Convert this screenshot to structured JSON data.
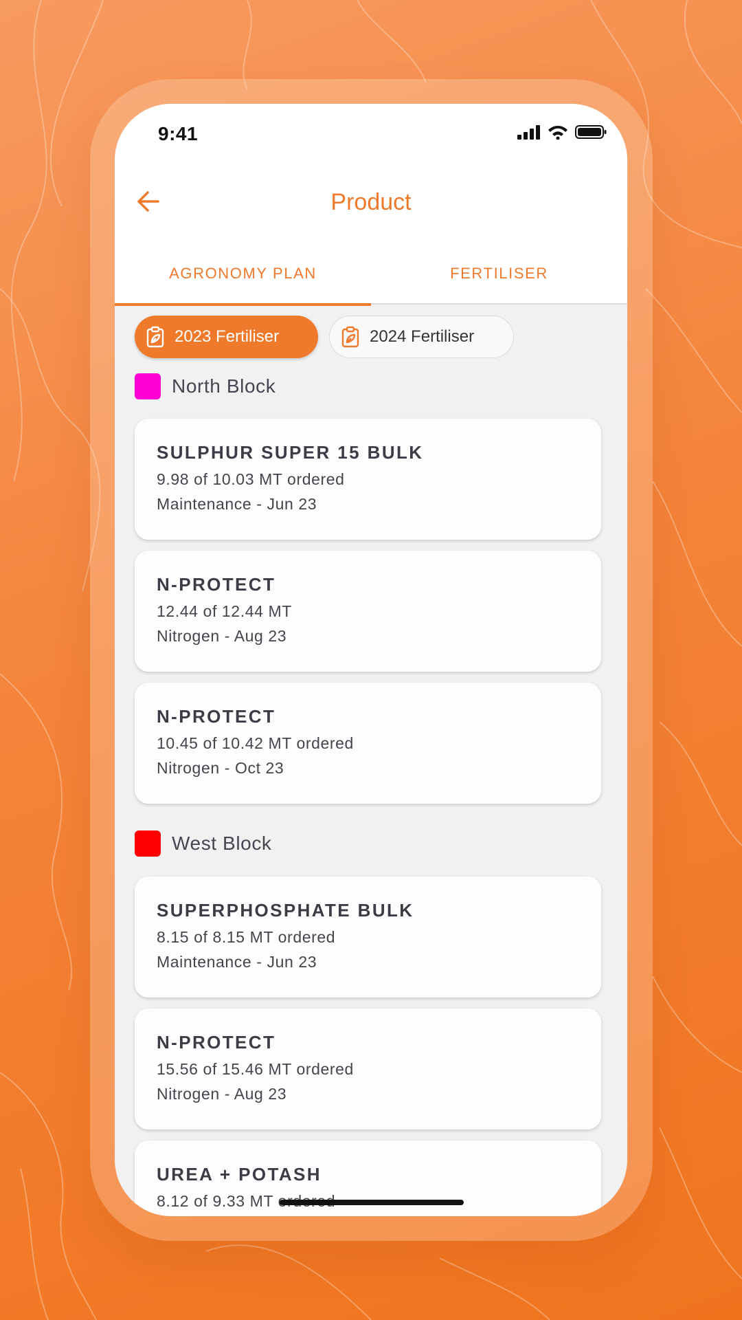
{
  "status_bar": {
    "time": "9:41"
  },
  "app_bar": {
    "title": "Product"
  },
  "tabs": [
    {
      "label": "AGRONOMY PLAN",
      "active": true
    },
    {
      "label": "FERTILISER",
      "active": false
    }
  ],
  "filter_chips": [
    {
      "label": "2023 Fertiliser",
      "selected": true
    },
    {
      "label": "2024 Fertiliser",
      "selected": false
    }
  ],
  "blocks": [
    {
      "name": "North Block",
      "color": "#ff00d4",
      "items": [
        {
          "product": "SULPHUR SUPER 15 BULK",
          "quantity": "9.98 of 10.03 MT ordered",
          "schedule": "Maintenance - Jun 23"
        },
        {
          "product": "N-PROTECT",
          "quantity": "12.44 of 12.44 MT",
          "schedule": "Nitrogen - Aug 23"
        },
        {
          "product": "N-PROTECT",
          "quantity": "10.45 of 10.42 MT ordered",
          "schedule": "Nitrogen - Oct 23"
        }
      ]
    },
    {
      "name": "West Block",
      "color": "#ff0000",
      "items": [
        {
          "product": "SUPERPHOSPHATE BULK",
          "quantity": "8.15 of 8.15 MT ordered",
          "schedule": "Maintenance - Jun 23"
        },
        {
          "product": "N-PROTECT",
          "quantity": "15.56 of 15.46 MT ordered",
          "schedule": "Nitrogen - Aug 23"
        },
        {
          "product": "UREA + POTASH",
          "quantity": "8.12 of 9.33 MT ordered",
          "schedule": ""
        }
      ]
    }
  ],
  "colors": {
    "accent": "#ef7a2c",
    "screen_background": "#f1f1f2"
  },
  "icons": {
    "back": "arrow-left-icon",
    "chip": "clipboard-leaf-icon",
    "signal": "cellular-signal-icon",
    "wifi": "wifi-icon",
    "battery": "battery-icon"
  }
}
